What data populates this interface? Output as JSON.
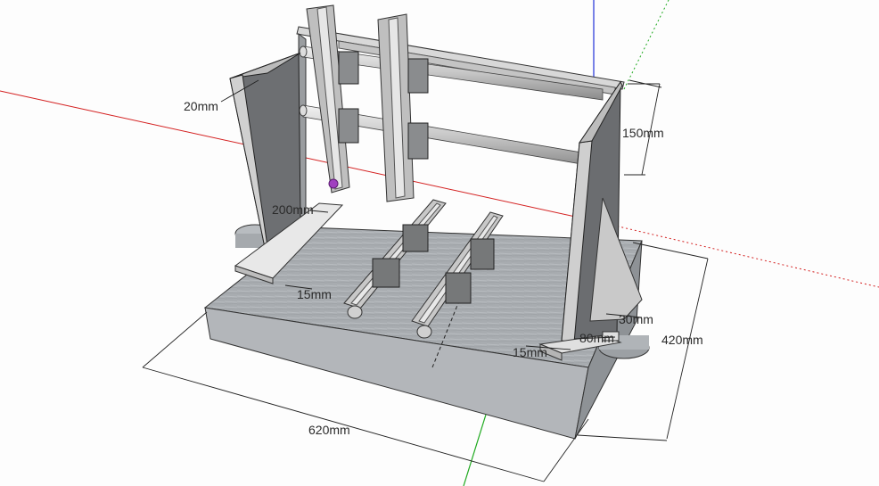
{
  "dimensions": {
    "d20": "20mm",
    "d150": "150mm",
    "d200": "200mm",
    "d15a": "15mm",
    "d30": "30mm",
    "d80": "80mm",
    "d420": "420mm",
    "d15b": "15mm",
    "d620": "620mm"
  },
  "colors": {
    "axis_red": "#d42020",
    "axis_green": "#1faa1f",
    "axis_blue": "#1f2fd8",
    "inference_point": "#a040c0"
  }
}
